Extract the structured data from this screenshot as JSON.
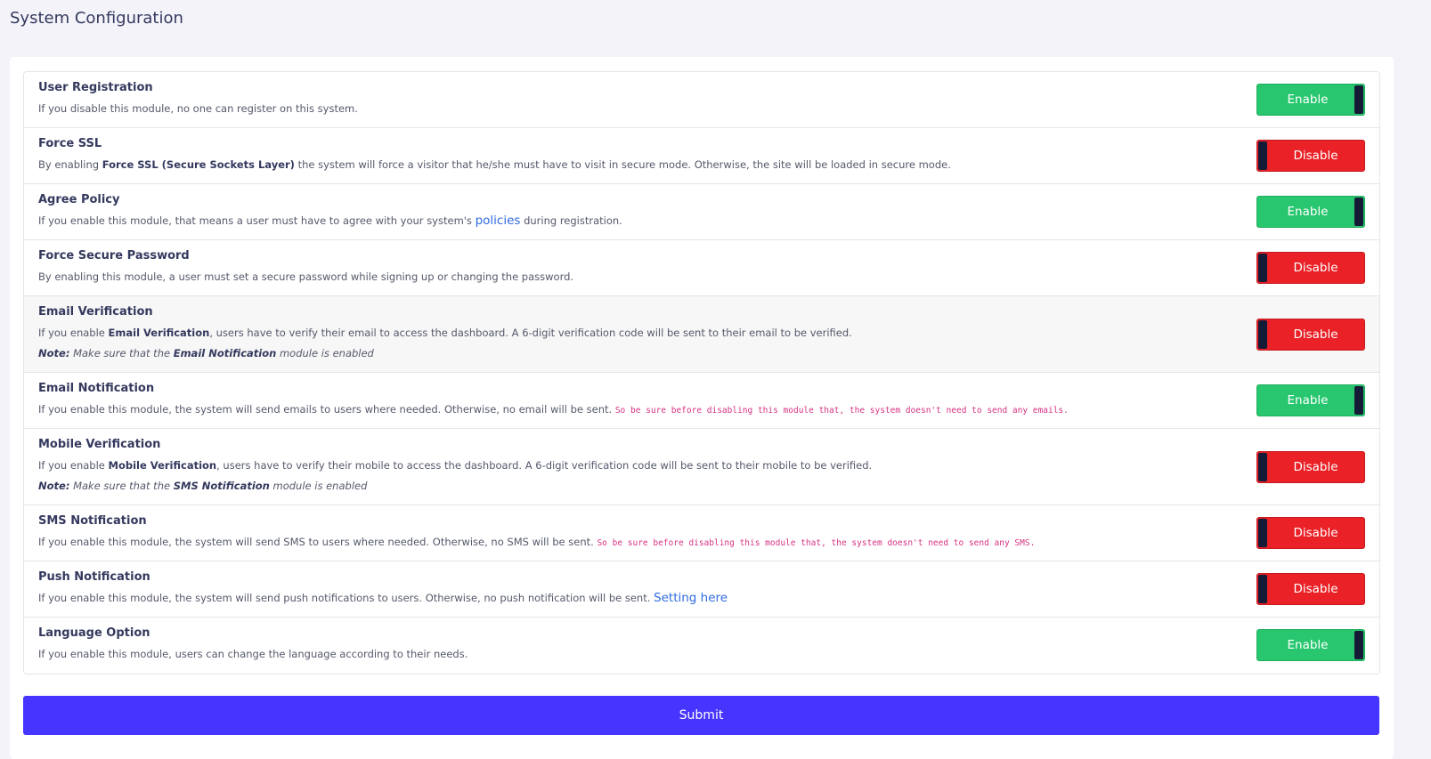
{
  "page": {
    "title": "System Configuration"
  },
  "modules": {
    "user_registration": {
      "title": "User Registration",
      "desc": "If you disable this module, no one can register on this system.",
      "toggle": "Enable"
    },
    "force_ssl": {
      "title": "Force SSL",
      "desc_pre": "By enabling ",
      "desc_bold": "Force SSL (Secure Sockets Layer)",
      "desc_post": " the system will force a visitor that he/she must have to visit in secure mode. Otherwise, the site will be loaded in secure mode.",
      "toggle": "Disable"
    },
    "agree_policy": {
      "title": "Agree Policy",
      "desc_pre": "If you enable this module, that means a user must have to agree with your system's ",
      "desc_link": "policies",
      "desc_post": " during registration.",
      "toggle": "Enable"
    },
    "force_secure_password": {
      "title": "Force Secure Password",
      "desc": "By enabling this module, a user must set a secure password while signing up or changing the password.",
      "toggle": "Disable"
    },
    "email_verification": {
      "title": "Email Verification",
      "desc_pre": "If you enable ",
      "desc_bold": "Email Verification",
      "desc_post": ", users have to verify their email to access the dashboard. A 6-digit verification code will be sent to their email to be verified.",
      "note_label": "Note:",
      "note_pre": " Make sure that the ",
      "note_bold": "Email Notification",
      "note_post": " module is enabled",
      "toggle": "Disable"
    },
    "email_notification": {
      "title": "Email Notification",
      "desc": "If you enable this module, the system will send emails to users where needed. Otherwise, no email will be sent.",
      "code": "So be sure before disabling this module that, the system doesn't need to send any emails.",
      "toggle": "Enable"
    },
    "mobile_verification": {
      "title": "Mobile Verification",
      "desc_pre": "If you enable ",
      "desc_bold": "Mobile Verification",
      "desc_post": ", users have to verify their mobile to access the dashboard. A 6-digit verification code will be sent to their mobile to be verified.",
      "note_label": "Note:",
      "note_pre": " Make sure that the ",
      "note_bold": "SMS Notification",
      "note_post": " module is enabled",
      "toggle": "Disable"
    },
    "sms_notification": {
      "title": "SMS Notification",
      "desc": "If you enable this module, the system will send SMS to users where needed. Otherwise, no SMS will be sent.",
      "code": "So be sure before disabling this module that, the system doesn't need to send any SMS.",
      "toggle": "Disable"
    },
    "push_notification": {
      "title": "Push Notification",
      "desc": "If you enable this module, the system will send push notifications to users. Otherwise, no push notification will be sent. ",
      "link": "Setting here",
      "toggle": "Disable"
    },
    "language_option": {
      "title": "Language Option",
      "desc": "If you enable this module, users can change the language according to their needs.",
      "toggle": "Enable"
    }
  },
  "submit_label": "Submit",
  "colors": {
    "enable": "#28c76f",
    "disable": "#ea2127",
    "knob": "#151a36",
    "submit": "#4634ff",
    "link": "#2f6be0",
    "code": "#d63384"
  }
}
